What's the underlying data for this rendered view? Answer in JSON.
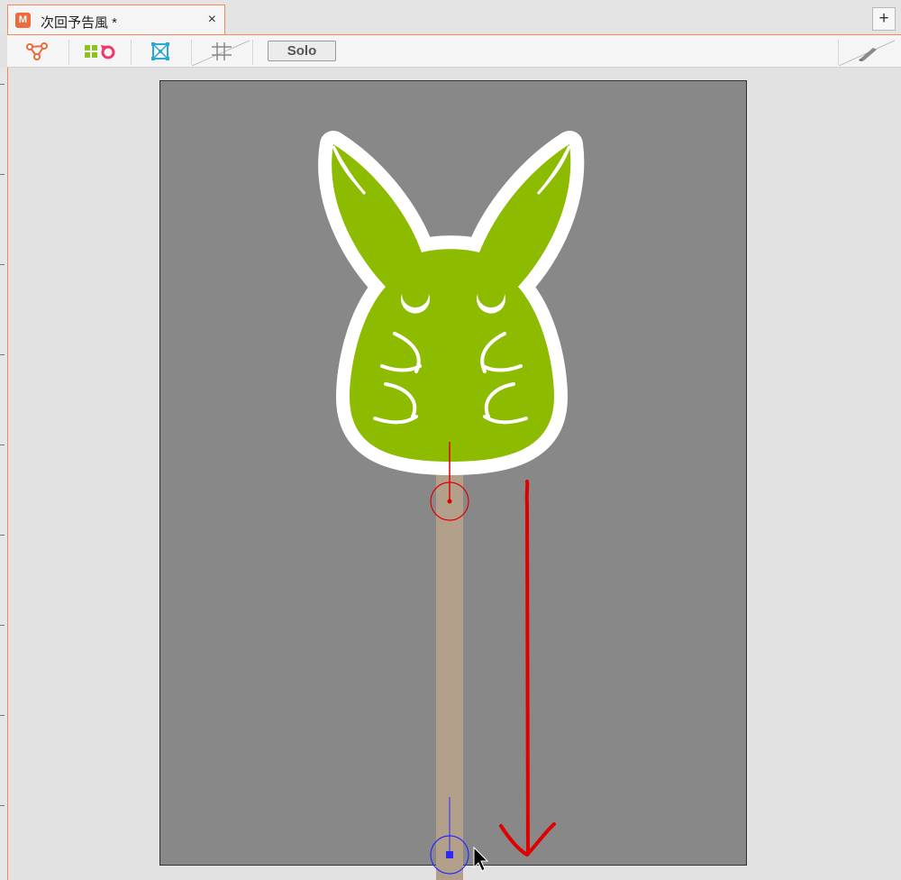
{
  "tab": {
    "logo": "M",
    "title": "次回予告風 *",
    "close": "×"
  },
  "add_button": "+",
  "toolbar": {
    "tools": [
      {
        "name": "bone-tool",
        "icon": "bone-icon"
      },
      {
        "name": "motion-tool",
        "icon": "motion-icon"
      },
      {
        "name": "mesh-tool",
        "icon": "mesh-icon"
      },
      {
        "name": "grid-tool",
        "icon": "grid-icon"
      }
    ],
    "solo_label": "Solo",
    "pen_icon": "pen-icon"
  },
  "canvas": {
    "background": "#888888",
    "character_color": "#8dbb00",
    "outline_color": "#ffffff",
    "stick_color": "#b3a08a",
    "annotation_color": "#e00000"
  }
}
